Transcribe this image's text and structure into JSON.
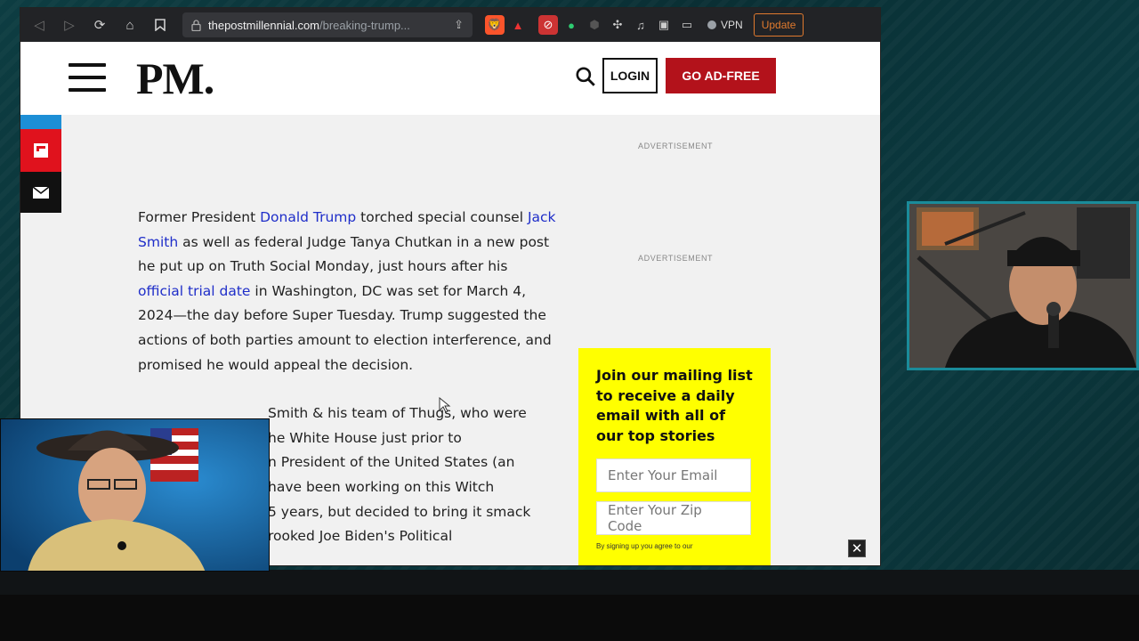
{
  "browser": {
    "url_host": "thepostmillennial.com",
    "url_path": "/breaking-trump...",
    "vpn_label": "VPN",
    "update_label": "Update"
  },
  "site": {
    "logo": "PM.",
    "login_label": "LOGIN",
    "adfree_label": "GO AD-FREE"
  },
  "ads": {
    "label_1": "ADVERTISEMENT",
    "label_2": "ADVERTISEMENT"
  },
  "article": {
    "p1_pre": "Former President ",
    "p1_link1": "Donald Trump",
    "p1_mid1": " torched special counsel ",
    "p1_link2": "Jack Smith",
    "p1_mid2": " as well as federal Judge Tanya Chutkan in a new post he put up on Truth Social Monday, just hours after his ",
    "p1_link3": "official trial date",
    "p1_post": " in Washington, DC was set for March 4, 2024—the day before Super Tuesday. Trump suggested the actions of both parties amount to election interference, and promised he would appeal the decision.",
    "quote_lines": [
      "Smith & his team of Thugs, who were",
      "he White House just prior to",
      "n President of the United States (an",
      "have been working on this Witch",
      "5 years, but decided to bring it smack",
      "rooked Joe Biden's Political"
    ]
  },
  "mailing": {
    "title": "Join our mailing list to receive a daily email with all of our top stories",
    "email_placeholder": "Enter Your Email",
    "zip_placeholder": "Enter Your Zip Code",
    "fine_print": "By signing up you agree to our"
  },
  "colors": {
    "brand_red": "#b3121b",
    "link_blue": "#1f2ec9",
    "mail_yellow": "#ffff00"
  }
}
